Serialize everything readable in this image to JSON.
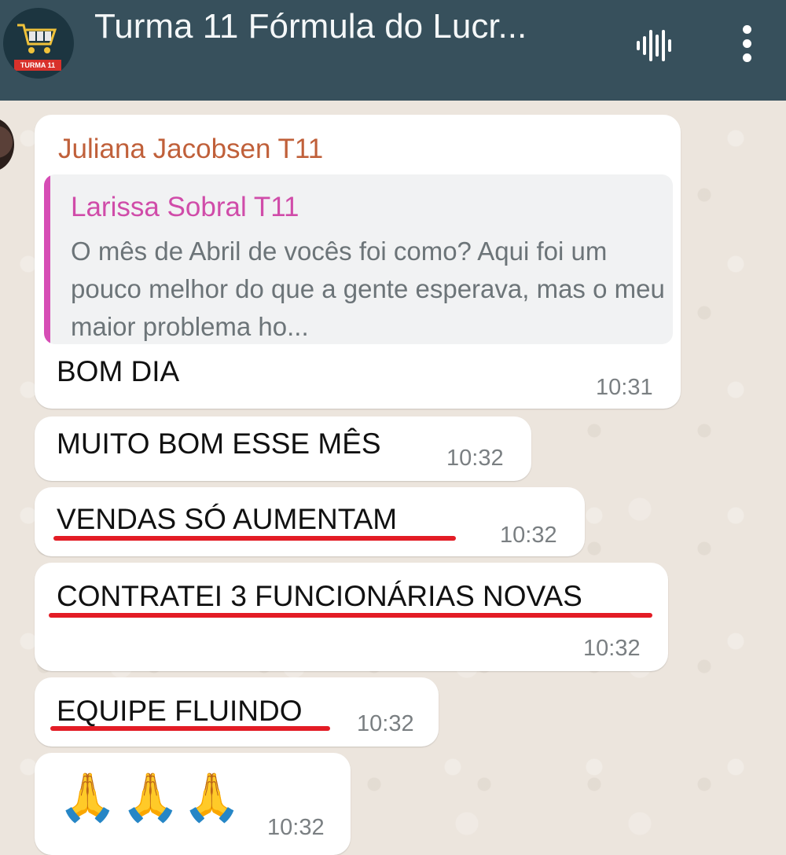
{
  "header": {
    "title": "Turma 11 Fórmula do Lucr...",
    "avatar_badge": "TURMA 11",
    "icons": [
      "audio-waveform-icon",
      "more-vertical-icon"
    ],
    "background_color": "#37505c"
  },
  "messages": {
    "first": {
      "sender": "Juliana Jacobsen T11",
      "quote_author": "Larissa Sobral T11",
      "quote_text": "O mês de Abril de vocês foi como? Aqui foi um pouco melhor do que a gente esperava, mas o meu maior problema ho...",
      "text": "BOM DIA",
      "time": "10:31"
    },
    "second": {
      "text": "MUITO BOM ESSE MÊS",
      "time": "10:32"
    },
    "third": {
      "text": "VENDAS SÓ AUMENTAM",
      "time": "10:32"
    },
    "fourth": {
      "text": "CONTRATEI 3 FUNCIONÁRIAS NOVAS",
      "time": "10:32"
    },
    "fifth": {
      "text": "EQUIPE FLUINDO",
      "time": "10:32"
    },
    "sixth": {
      "emojis": [
        "🙏",
        "🙏",
        "🙏"
      ],
      "time": "10:32"
    }
  },
  "colors": {
    "underline": "#e31c25",
    "sender_name": "#c0603a",
    "quote_name": "#d04ca9",
    "quote_bar": "#d64db5"
  }
}
